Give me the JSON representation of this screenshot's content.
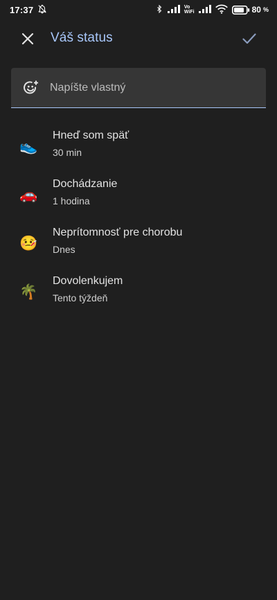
{
  "status_bar": {
    "time": "17:37",
    "volte_top": "Vo",
    "volte_bottom": "WiFi",
    "battery": "80"
  },
  "app_bar": {
    "title": "Váš status",
    "close_icon": "close-icon",
    "check_icon": "check-icon"
  },
  "input": {
    "placeholder": "Napíšte vlastný",
    "value": ""
  },
  "items": [
    {
      "emoji": "👟",
      "icon": "running-shoe-icon",
      "title": "Hneď som späť",
      "subtitle": "30 min"
    },
    {
      "emoji": "🚗",
      "icon": "car-icon",
      "title": "Dochádzanie",
      "subtitle": "1 hodina"
    },
    {
      "emoji": "🤒",
      "icon": "sick-face-icon",
      "title": "Neprítomnosť pre chorobu",
      "subtitle": "Dnes"
    },
    {
      "emoji": "🌴",
      "icon": "palm-tree-icon",
      "title": "Dovolenkujem",
      "subtitle": "Tento týždeň"
    }
  ],
  "colors": {
    "background": "#1f1f1f",
    "accent": "#a8c7fa",
    "input_bg": "#363636"
  }
}
